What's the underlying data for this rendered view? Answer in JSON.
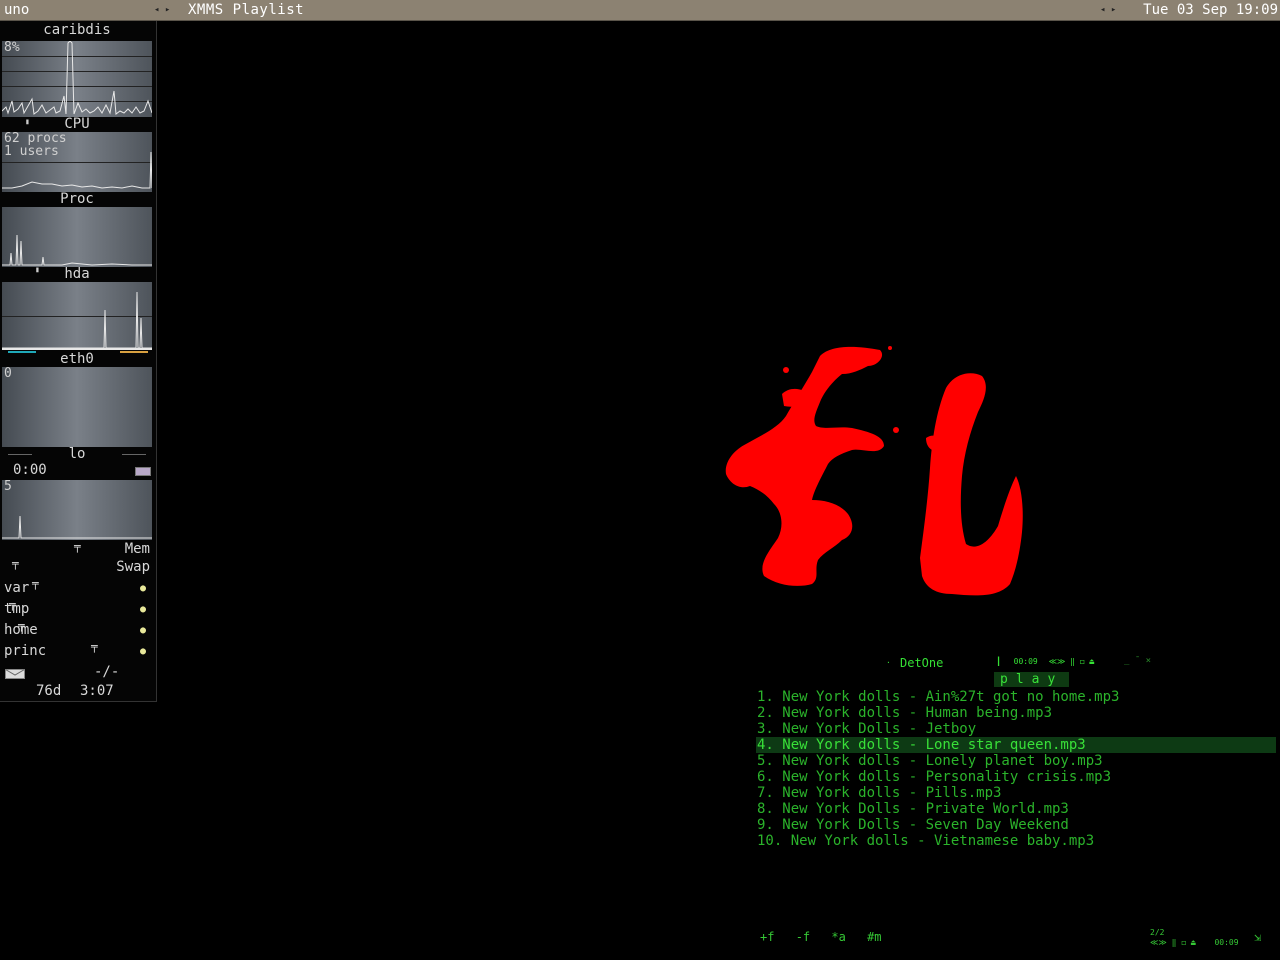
{
  "topbar": {
    "workspace": "uno",
    "title": "XMMS Playlist",
    "clock": "Tue 03 Sep 19:09"
  },
  "gkrellm": {
    "hostname": "caribdis",
    "cpu": {
      "label": "CPU",
      "percent_text": "8%"
    },
    "proc": {
      "label": "Proc",
      "procs": "62 procs",
      "users": " 1 users"
    },
    "disk": {
      "label": "hda"
    },
    "net_eth0": {
      "label": "eth0",
      "value": "0"
    },
    "net_lo": {
      "label": "lo",
      "timer": "0:00",
      "value": "5"
    },
    "mem": {
      "label": "Mem",
      "level": 0.5
    },
    "swap": {
      "label": "Swap",
      "level": 0.08
    },
    "fs": [
      {
        "name": "var",
        "level": 0.22
      },
      {
        "name": "tmp",
        "level": 0.06
      },
      {
        "name": "home",
        "level": 0.13
      },
      {
        "name": "princ",
        "level": 0.62
      }
    ],
    "mail": "-/-",
    "uptime_days": "76d",
    "uptime_time": "3:07"
  },
  "playlist": {
    "header_name": "DetOne",
    "header_time": "00:09",
    "play_label": "play",
    "items": [
      "1. New York dolls - Ain%27t got no home.mp3",
      "2. New York dolls - Human being.mp3",
      "3. New York Dolls - Jetboy",
      "4. New York dolls - Lone star queen.mp3",
      "5. New York dolls - Lonely planet boy.mp3",
      "6. New York dolls - Personality crisis.mp3",
      "7. New York dolls - Pills.mp3",
      "8. New York Dolls - Private World.mp3",
      "9. New York Dolls - Seven Day Weekend",
      "10. New York dolls - Vietnamese baby.mp3"
    ],
    "active_index": 3,
    "footer_buttons": [
      "+f",
      "-f",
      "*a",
      "#m"
    ],
    "footer_count": "2/2",
    "footer_time": "00:09"
  },
  "colors": {
    "logo_red": "#ff0000",
    "playlist_green": "#2bb32b",
    "playlist_active_bg": "#0d3a14",
    "topbar_bg": "#8c8272"
  }
}
